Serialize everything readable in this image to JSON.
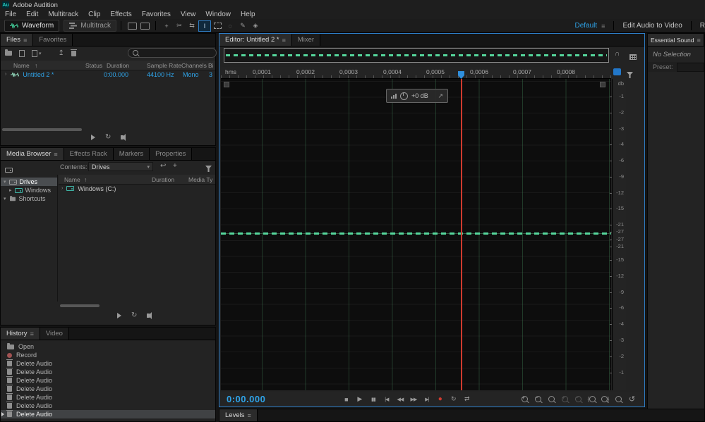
{
  "ui": {
    "menu_glyph": "≡",
    "caret_down": "▾",
    "caret_right": "▸",
    "sort_up": "↑",
    "expand_right": "›"
  },
  "colors": {
    "accent_blue": "#2d7cc4",
    "text_blue": "#2fa3e8",
    "waveform_green": "#55d79c",
    "playhead_red": "#cf3a2e"
  },
  "titlebar": {
    "logo_text": "Au",
    "app_title": "Adobe Audition"
  },
  "menubar": {
    "items": [
      "File",
      "Edit",
      "Multitrack",
      "Clip",
      "Effects",
      "Favorites",
      "View",
      "Window",
      "Help"
    ]
  },
  "toolbar": {
    "waveform_label": "Waveform",
    "multitrack_label": "Multitrack",
    "workspace_label": "Default",
    "edit_audio_to_video_label": "Edit Audio to Video",
    "clipped_right_label": "R",
    "tool_glyphs": {
      "move": "+",
      "razor": "✂",
      "slip": "⇆",
      "time_selection": "I",
      "lasso": "◌",
      "brush": "✎",
      "heal": "◈"
    }
  },
  "files_panel": {
    "tabs": {
      "files": "Files",
      "favorites": "Favorites"
    },
    "columns": [
      "Name",
      "Status",
      "Duration",
      "Sample Rate",
      "Channels",
      "Bi"
    ],
    "rows": [
      {
        "name": "Untitled 2 *",
        "status": "",
        "duration": "0:00.000",
        "sample_rate": "44100 Hz",
        "channels": "Mono",
        "bit": "3"
      }
    ]
  },
  "media_panel": {
    "tabs": [
      "Media Browser",
      "Effects Rack",
      "Markers",
      "Properties"
    ],
    "contents_label": "Contents:",
    "contents_value": "Drives",
    "tree": {
      "drives": "Drives",
      "windows": "Windows",
      "shortcuts": "Shortcuts"
    },
    "columns": [
      "Name",
      "Duration",
      "Media Ty"
    ],
    "rows": [
      {
        "name": "Windows (C:)"
      }
    ]
  },
  "history_panel": {
    "tabs": [
      "History",
      "Video"
    ],
    "items": [
      {
        "label": "Open",
        "icon": "folder"
      },
      {
        "label": "Record",
        "icon": "record"
      },
      {
        "label": "Delete Audio",
        "icon": "trash"
      },
      {
        "label": "Delete Audio",
        "icon": "trash"
      },
      {
        "label": "Delete Audio",
        "icon": "trash"
      },
      {
        "label": "Delete Audio",
        "icon": "trash"
      },
      {
        "label": "Delete Audio",
        "icon": "trash"
      },
      {
        "label": "Delete Audio",
        "icon": "trash"
      },
      {
        "label": "Delete Audio",
        "icon": "trash"
      }
    ]
  },
  "editor": {
    "tabs": {
      "editor": "Editor: Untitled 2 *",
      "mixer": "Mixer"
    },
    "ruler_unit": "hms",
    "ruler_labels": [
      "0,0001",
      "0,0002",
      "0,0003",
      "0,0004",
      "0,0005",
      "0,0006",
      "0,0007",
      "0,0008"
    ],
    "hud_gain": "+0 dB",
    "db_unit": "db",
    "db_top": [
      "-1",
      "-2",
      "-3",
      "-4",
      "-6",
      "-9",
      "-12",
      "-15",
      "-21",
      "-27"
    ],
    "db_bottom": [
      "-27",
      "-21",
      "-15",
      "-12",
      "-9",
      "-6",
      "-4",
      "-3",
      "-2",
      "-1"
    ],
    "transport": {
      "time": "0:00.000",
      "buttons": [
        {
          "name": "stop",
          "glyph": "■"
        },
        {
          "name": "play",
          "glyph": "▶"
        },
        {
          "name": "pause",
          "glyph": "▮▮"
        },
        {
          "name": "skip-to-start",
          "glyph": "|◀"
        },
        {
          "name": "rewind",
          "glyph": "◀◀"
        },
        {
          "name": "fast-forward",
          "glyph": "▶▶"
        },
        {
          "name": "skip-to-end",
          "glyph": "▶|"
        },
        {
          "name": "record",
          "glyph": "●"
        },
        {
          "name": "loop-playback",
          "glyph": "↻"
        },
        {
          "name": "skip-selection",
          "glyph": "⇄"
        }
      ],
      "zoom_buttons": [
        "zoom-in-time",
        "zoom-out-time",
        "zoom-to-selection",
        "zoom-in-amplitude",
        "zoom-out-amplitude",
        "zoom-selection-in-point",
        "zoom-selection-out-point",
        "zoom-full",
        "reset-zoom"
      ]
    }
  },
  "essential_sound": {
    "title": "Essential Sound",
    "no_selection": "No Selection",
    "preset_label": "Preset:"
  },
  "levels_panel": {
    "label": "Levels"
  }
}
